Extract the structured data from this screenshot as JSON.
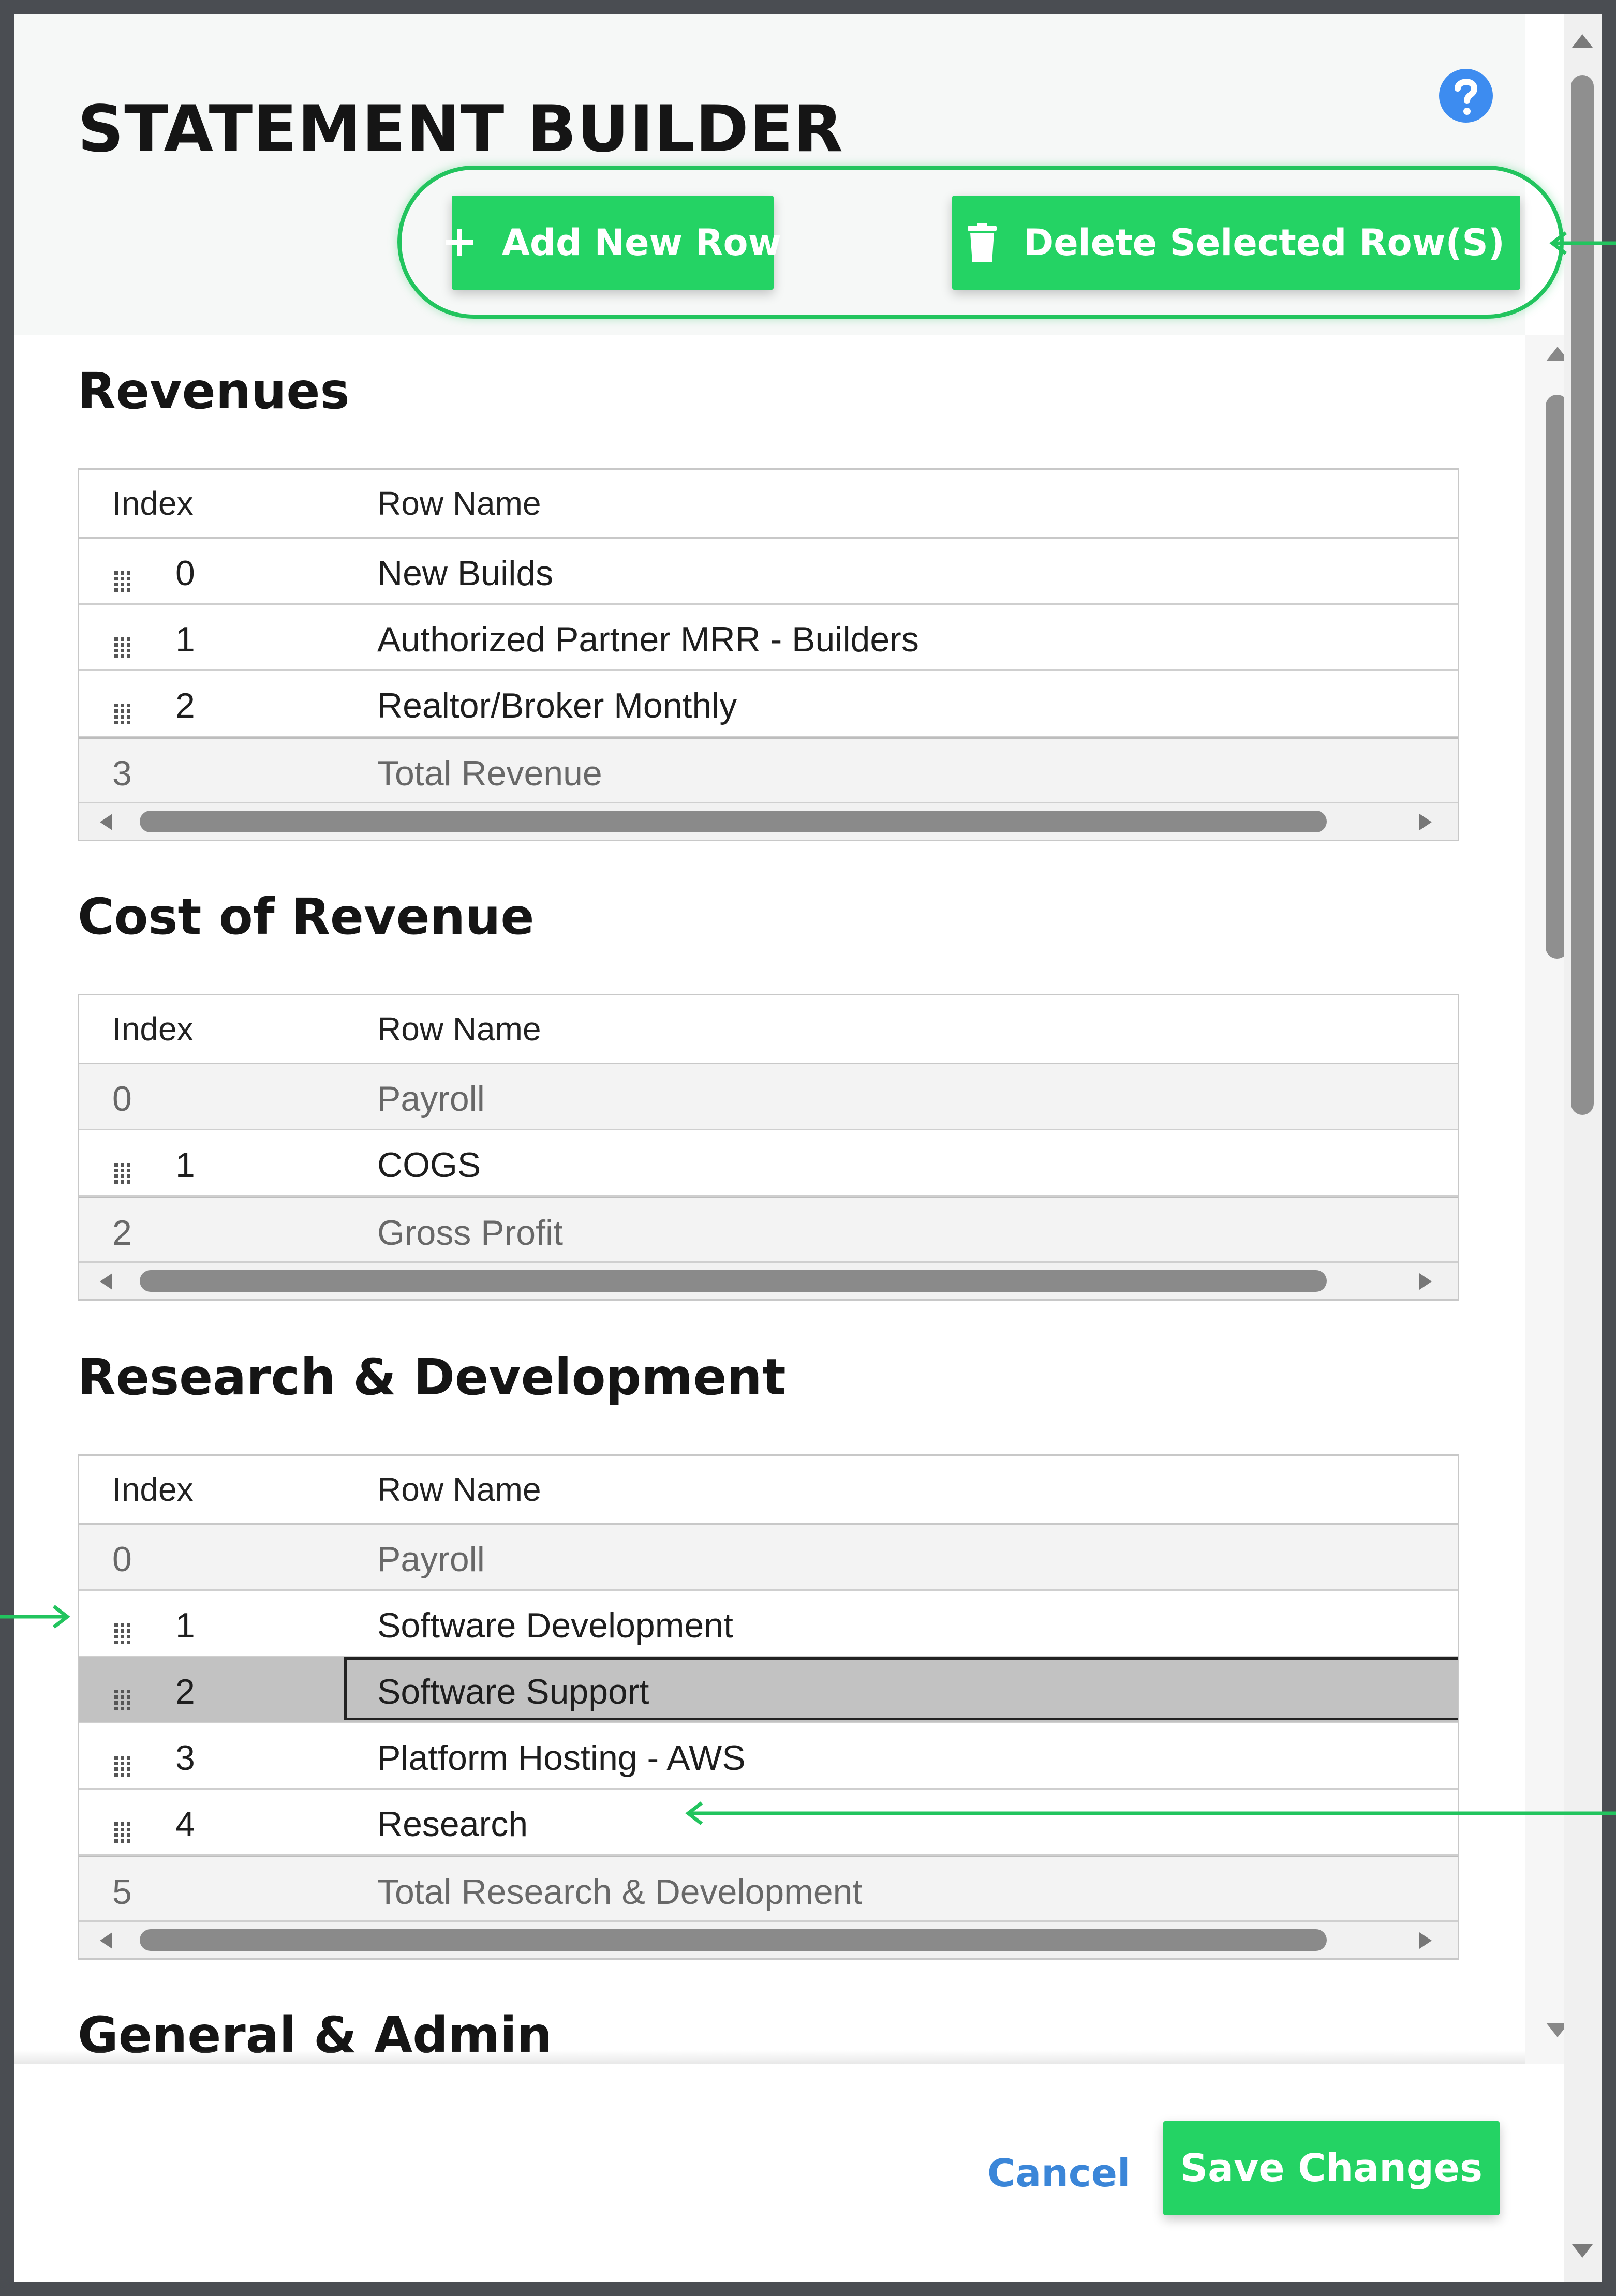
{
  "dialog": {
    "title": "STATEMENT BUILDER",
    "help_icon": "question-circle-icon"
  },
  "toolbar": {
    "add_label": "Add New Row",
    "add_icon": "plus-icon",
    "delete_label": "Delete Selected Row(S)",
    "delete_icon": "trash-icon"
  },
  "grid_headers": {
    "index": "Index",
    "row_name": "Row Name"
  },
  "sections": [
    {
      "title": "Revenues",
      "rows": [
        {
          "index": "0",
          "name": "New Builds",
          "draggable": true
        },
        {
          "index": "1",
          "name": "Authorized Partner MRR - Builders",
          "draggable": true
        },
        {
          "index": "2",
          "name": "Realtor/Broker Monthly",
          "draggable": true
        },
        {
          "index": "3",
          "name": "Total Revenue",
          "draggable": false,
          "total": true
        }
      ]
    },
    {
      "title": "Cost of Revenue",
      "rows": [
        {
          "index": "0",
          "name": "Payroll",
          "draggable": false
        },
        {
          "index": "1",
          "name": "COGS",
          "draggable": true
        },
        {
          "index": "2",
          "name": "Gross Profit",
          "draggable": false,
          "total": true
        }
      ]
    },
    {
      "title": "Research & Development",
      "rows": [
        {
          "index": "0",
          "name": "Payroll",
          "draggable": false
        },
        {
          "index": "1",
          "name": "Software Development",
          "draggable": true
        },
        {
          "index": "2",
          "name": "Software Support",
          "draggable": true,
          "selected": true
        },
        {
          "index": "3",
          "name": "Platform Hosting - AWS",
          "draggable": true
        },
        {
          "index": "4",
          "name": "Research",
          "draggable": true
        },
        {
          "index": "5",
          "name": "Total Research & Development",
          "draggable": false,
          "total": true
        }
      ]
    },
    {
      "title": "General & Admin",
      "rows": []
    }
  ],
  "footer": {
    "cancel_label": "Cancel",
    "save_label": "Save Changes"
  },
  "colors": {
    "accent_green": "#24d364",
    "link_blue": "#3b86d8",
    "help_blue": "#3d8cf0",
    "selected_row": "#c2c2c2"
  }
}
